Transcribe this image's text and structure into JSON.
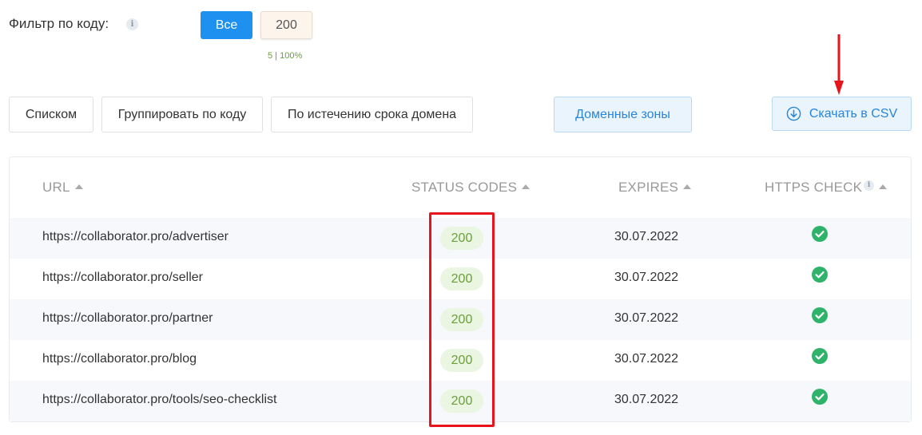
{
  "filter": {
    "label": "Фильтр по коду:",
    "all_label": "Все",
    "code_label": "200",
    "count_text": "5 | 100%"
  },
  "views": {
    "list_label": "Списком",
    "group_label": "Группировать по коду",
    "expire_label": "По истечению срока домена",
    "zones_label": "Доменные зоны",
    "csv_label": "Скачать в CSV"
  },
  "table": {
    "headers": {
      "url": "URL",
      "status": "STATUS CODES",
      "expires": "EXPIRES",
      "https": "HTTPS CHECK"
    },
    "rows": [
      {
        "url": "https://collaborator.pro/advertiser",
        "status": "200",
        "expires": "30.07.2022",
        "https": "check-circle-icon"
      },
      {
        "url": "https://collaborator.pro/seller",
        "status": "200",
        "expires": "30.07.2022",
        "https": "check-circle-icon"
      },
      {
        "url": "https://collaborator.pro/partner",
        "status": "200",
        "expires": "30.07.2022",
        "https": "check-circle-icon"
      },
      {
        "url": "https://collaborator.pro/blog",
        "status": "200",
        "expires": "30.07.2022",
        "https": "check-circle-icon"
      },
      {
        "url": "https://collaborator.pro/tools/seo-checklist",
        "status": "200",
        "expires": "30.07.2022",
        "https": "check-circle-icon"
      }
    ]
  },
  "colors": {
    "primary": "#1e90f0",
    "success": "#2fb36b",
    "annotation": "#e8141b"
  }
}
